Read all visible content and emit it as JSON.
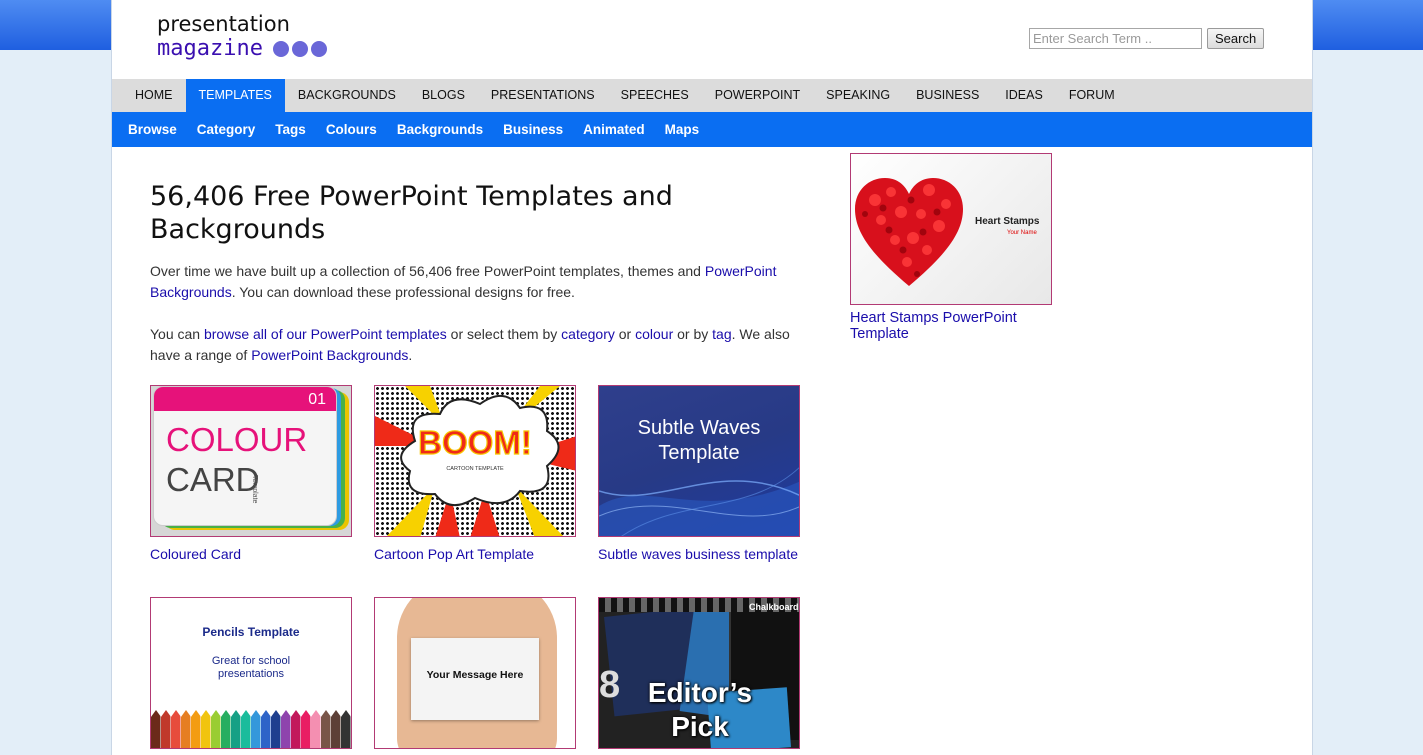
{
  "logo": {
    "line1": "presentation",
    "line2": "magazine"
  },
  "search": {
    "placeholder": "Enter Search Term ..",
    "button": "Search"
  },
  "main_nav": [
    "HOME",
    "TEMPLATES",
    "BACKGROUNDS",
    "BLOGS",
    "PRESENTATIONS",
    "SPEECHES",
    "POWERPOINT",
    "SPEAKING",
    "BUSINESS",
    "IDEAS",
    "FORUM"
  ],
  "main_nav_active": "TEMPLATES",
  "sub_nav": [
    "Browse",
    "Category",
    "Tags",
    "Colours",
    "Backgrounds",
    "Business",
    "Animated",
    "Maps"
  ],
  "content": {
    "title": "56,406 Free PowerPoint Templates and Backgrounds",
    "p1": {
      "t1": "Over time we have built up a collection of 56,406 free PowerPoint templates, themes and ",
      "link1": "PowerPoint Backgrounds",
      "t2": ". You can download these professional designs for free."
    },
    "p2": {
      "t1": "You can ",
      "link1": "browse all of our PowerPoint templates",
      "t2": " or select them by ",
      "link2": "category",
      "t3": " or ",
      "link3": "colour",
      "t4": " or by ",
      "link4": "tag",
      "t5": ". We also have a range of ",
      "link5": "PowerPoint Backgrounds",
      "t6": "."
    }
  },
  "templates": [
    {
      "label": "Coloured Card",
      "thumb": {
        "tab": "01",
        "word1": "COLOUR",
        "word2": "CARD",
        "word3": "Template"
      }
    },
    {
      "label": "Cartoon Pop Art Template",
      "thumb": {
        "word": "BOOM!",
        "sub": "CARTOON TEMPLATE"
      }
    },
    {
      "label": "Subtle waves business template",
      "thumb": {
        "line1": "Subtle Waves",
        "line2": "Template"
      }
    },
    {
      "label": "",
      "thumb": {
        "title": "Pencils Template",
        "sub1": "Great for school",
        "sub2": "presentations"
      }
    },
    {
      "label": "",
      "thumb": {
        "text": "Your Message Here"
      }
    },
    {
      "label": "",
      "thumb": {
        "line1": "Editor’s",
        "line2": "Pick",
        "corner": "Chalkboard",
        "num": "8"
      }
    }
  ],
  "sidebar": {
    "label": "Heart Stamps PowerPoint Template",
    "thumb": {
      "title": "Heart Stamps",
      "sub": "Your Name"
    }
  },
  "colors": {
    "nav_blue": "#0a6ef2",
    "link": "#1a0dab",
    "thumb_border": "#b23a74",
    "logo_purple": "#3a0fb0"
  }
}
